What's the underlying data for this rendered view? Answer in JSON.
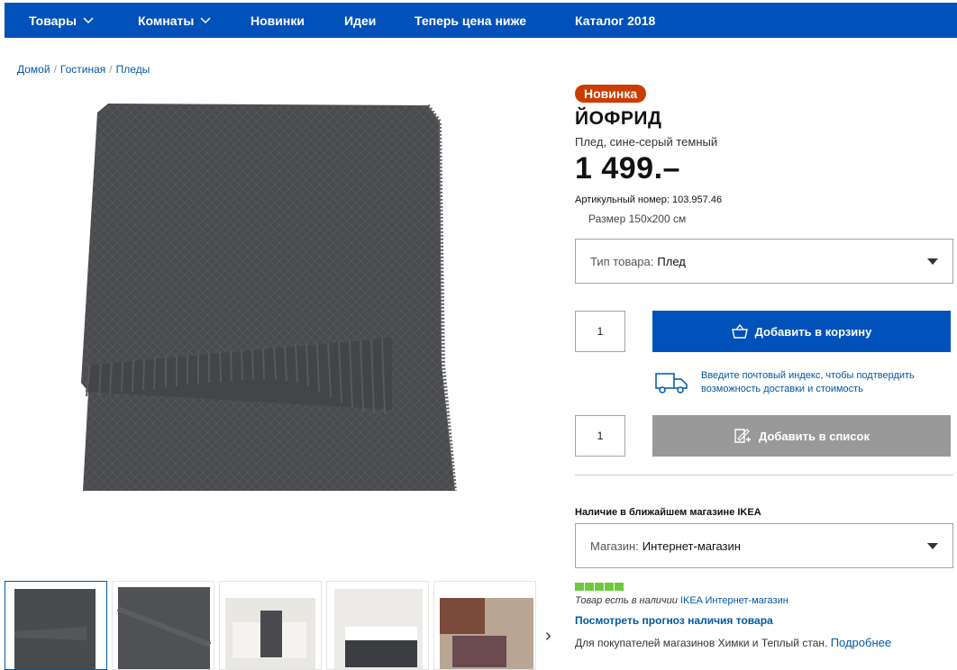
{
  "nav": {
    "items": [
      {
        "label": "Товары",
        "has_dropdown": true
      },
      {
        "label": "Комнаты",
        "has_dropdown": true
      },
      {
        "label": "Новинки",
        "has_dropdown": false
      },
      {
        "label": "Идеи",
        "has_dropdown": false
      },
      {
        "label": "Теперь цена ниже",
        "has_dropdown": false
      },
      {
        "label": "Каталог 2018",
        "has_dropdown": false
      }
    ],
    "bg_color": "#0051ba"
  },
  "breadcrumb": [
    "Домой",
    "Гостиная",
    "Пледы"
  ],
  "product": {
    "badge": "Новинка",
    "name": "ЙОФРИД",
    "description": "Плед, сине-серый темный",
    "price": "1 499.–",
    "article": "Артикульный номер: 103.957.46",
    "size_label": "Размер",
    "size_value": "150x200 см"
  },
  "type_select": {
    "label": "Тип товара:",
    "value": "Плед"
  },
  "cart": {
    "qty": "1",
    "button": "Добавить в корзину",
    "icon": "basket-icon"
  },
  "delivery": {
    "text": "Введите почтовый индекс, чтобы подтвердить возможность доставки и стоимость",
    "icon": "truck-icon"
  },
  "list": {
    "qty": "1",
    "button": "Добавить в список",
    "icon": "list-add-icon"
  },
  "availability": {
    "heading": "Наличие в ближайшем магазине IKEA",
    "store_label": "Магазин:",
    "store_value": "Интернет-магазин",
    "stock_text": "Товар есть в наличии",
    "stock_link": "IKEA Интернет-магазин",
    "forecast_link": "Посмотреть прогноз наличия товара",
    "note": "Для покупателей магазинов Химки и Теплый стан.",
    "note_link": "Подробнее",
    "stock_color": "#6dc93d"
  }
}
